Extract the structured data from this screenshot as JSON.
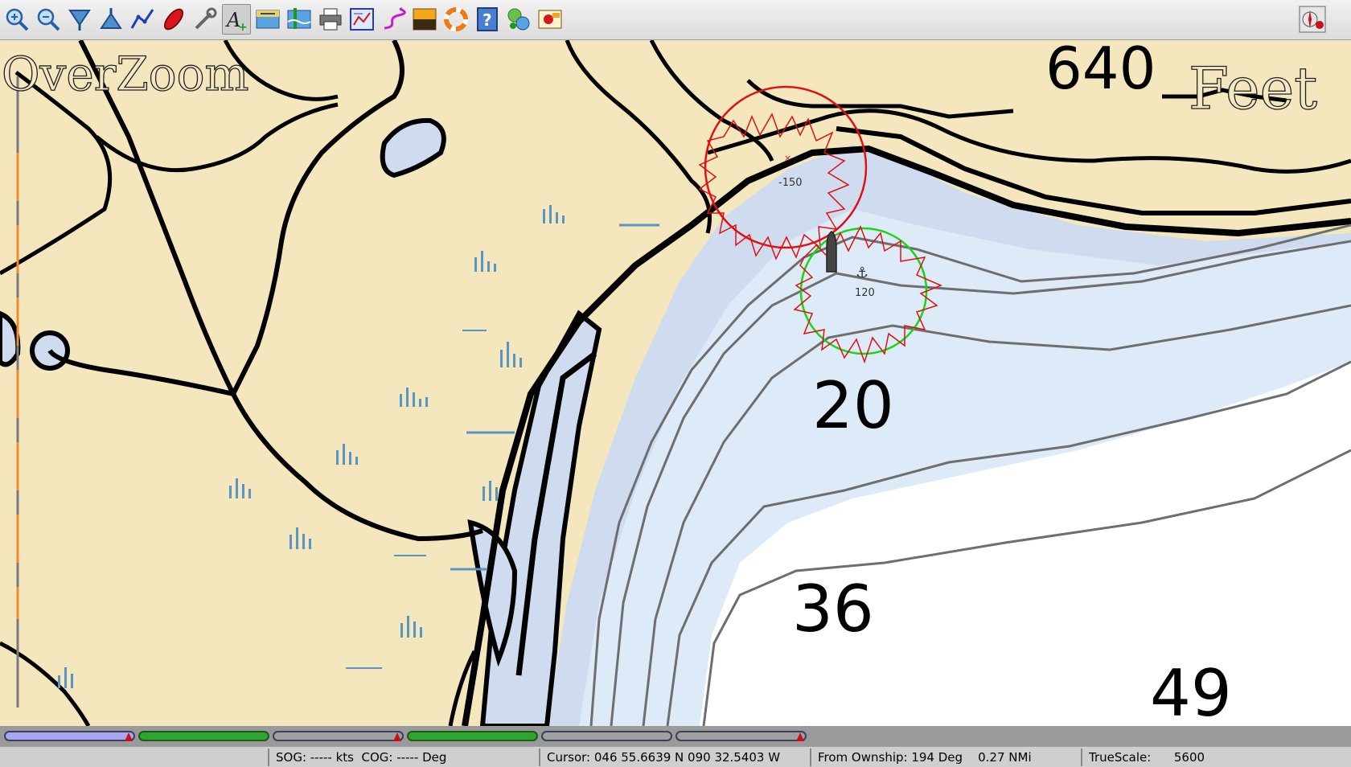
{
  "toolbar": {
    "buttons": [
      {
        "id": "zoom-in-icon",
        "label": "Zoom In"
      },
      {
        "id": "zoom-out-icon",
        "label": "Zoom Out"
      },
      {
        "id": "scale-down-icon",
        "label": "Shift chart"
      },
      {
        "id": "scale-up-icon",
        "label": "Scale In"
      },
      {
        "id": "route-icon",
        "label": "Create Route"
      },
      {
        "id": "auto-follow-icon",
        "label": "Auto Follow"
      },
      {
        "id": "settings-icon",
        "label": "Options"
      },
      {
        "id": "text-icon",
        "label": "Show ENC Text"
      },
      {
        "id": "current-icon",
        "label": "Show Currents"
      },
      {
        "id": "tide-icon",
        "label": "Show Tides"
      },
      {
        "id": "print-icon",
        "label": "Print Chart"
      },
      {
        "id": "route-manager-icon",
        "label": "Route & Mark Manager"
      },
      {
        "id": "track-icon",
        "label": "Enable Tracking"
      },
      {
        "id": "color-scheme-icon",
        "label": "Change Color Scheme"
      },
      {
        "id": "mob-icon",
        "label": "Drop MOB Marker"
      },
      {
        "id": "help-icon",
        "label": "About"
      },
      {
        "id": "plugin1-icon",
        "label": "Plugin"
      },
      {
        "id": "plugin2-icon",
        "label": "Plugin"
      }
    ],
    "right_button": {
      "id": "compass-icon",
      "label": "Compass"
    }
  },
  "chart": {
    "overzoom_label": "OverZoom",
    "units_label": "Feet",
    "contour_label": "640",
    "soundings": [
      "20",
      "36",
      "49"
    ],
    "anchor_watch_1": "-150",
    "anchor_watch_2": "120",
    "colors": {
      "land": "#f4e6bd",
      "shallow": "#cfdcf0",
      "medium": "#ddeaf7",
      "deep": "#ffffff",
      "watch_red": "#e01010",
      "watch_green": "#19d419"
    }
  },
  "piano": {
    "keys": [
      {
        "type": "blue"
      },
      {
        "type": "green"
      },
      {
        "type": "outline"
      },
      {
        "type": "green"
      },
      {
        "type": "outline"
      },
      {
        "type": "outline"
      }
    ]
  },
  "status": {
    "sog_cog": "SOG: ----- kts  COG: ----- Deg",
    "cursor": "Cursor: 046 55.6639 N 090 32.5403 W",
    "from_ownship": "From Ownship: 194 Deg    0.27 NMi",
    "truescale": "TrueScale:      5600"
  }
}
